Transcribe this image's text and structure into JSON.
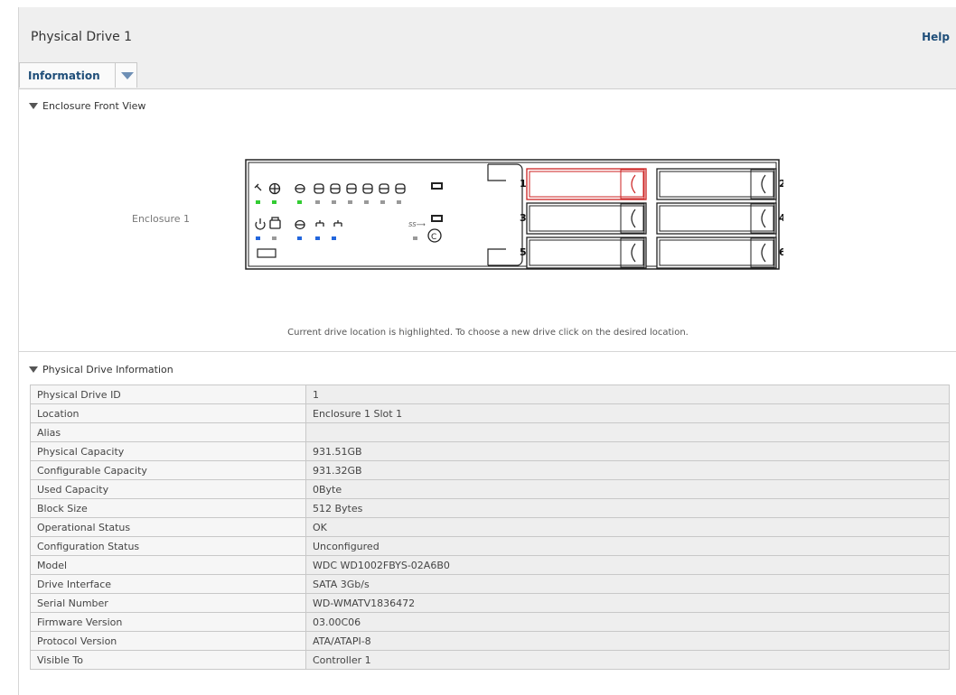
{
  "header": {
    "title": "Physical Drive 1",
    "help_label": "Help"
  },
  "tabs": [
    {
      "label": "Information",
      "active": true
    }
  ],
  "enclosure_section": {
    "title": "Enclosure Front View",
    "enclosure_label": "Enclosure 1",
    "hint": "Current drive location is highlighted. To choose a new drive click on the desired location.",
    "slots": [
      "1",
      "2",
      "3",
      "4",
      "5",
      "6"
    ],
    "selected_slot": "1",
    "highlight_color": "#cc2222"
  },
  "info_section": {
    "title": "Physical Drive Information",
    "rows": [
      {
        "label": "Physical Drive ID",
        "value": "1"
      },
      {
        "label": "Location",
        "value": "Enclosure 1 Slot 1"
      },
      {
        "label": "Alias",
        "value": ""
      },
      {
        "label": "Physical Capacity",
        "value": "931.51GB"
      },
      {
        "label": "Configurable Capacity",
        "value": "931.32GB"
      },
      {
        "label": "Used Capacity",
        "value": "0Byte"
      },
      {
        "label": "Block Size",
        "value": "512 Bytes"
      },
      {
        "label": "Operational Status",
        "value": "OK"
      },
      {
        "label": "Configuration Status",
        "value": "Unconfigured"
      },
      {
        "label": "Model",
        "value": "WDC WD1002FBYS-02A6B0"
      },
      {
        "label": "Drive Interface",
        "value": "SATA 3Gb/s"
      },
      {
        "label": "Serial Number",
        "value": "WD-WMATV1836472"
      },
      {
        "label": "Firmware Version",
        "value": "03.00C06"
      },
      {
        "label": "Protocol Version",
        "value": "ATA/ATAPI-8"
      },
      {
        "label": "Visible To",
        "value": "Controller 1"
      }
    ]
  }
}
